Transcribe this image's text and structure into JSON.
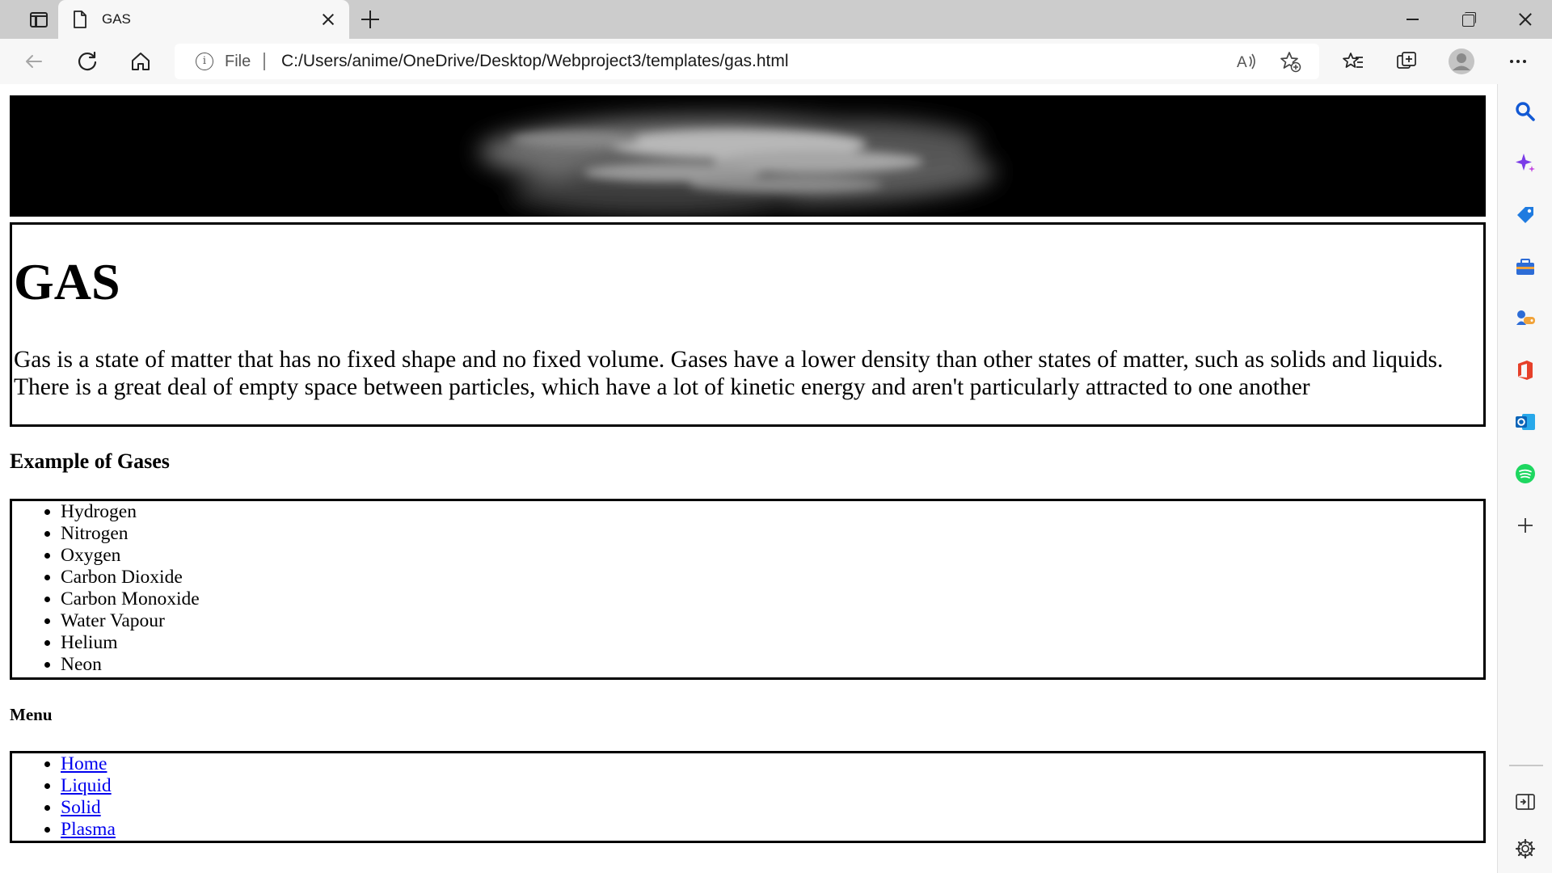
{
  "browser": {
    "tab_title": "GAS",
    "address_scheme_label": "File",
    "url": "C:/Users/anime/OneDrive/Desktop/Webproject3/templates/gas.html",
    "accent_color": "#0078d4"
  },
  "sidebar": {
    "items": [
      "search-icon",
      "copilot-icon",
      "shopping-icon",
      "tools-icon",
      "games-icon",
      "office-icon",
      "outlook-icon",
      "spotify-icon",
      "add-icon"
    ],
    "bottom": [
      "hide-sidebar-icon",
      "settings-icon"
    ]
  },
  "page": {
    "title": "GAS",
    "description": "Gas is a state of matter that has no fixed shape and no fixed volume. Gases have a lower density than other states of matter, such as solids and liquids. There is a great deal of empty space between particles, which have a lot of kinetic energy and aren't particularly attracted to one another",
    "examples_heading": "Example of Gases",
    "examples": [
      "Hydrogen",
      "Nitrogen",
      "Oxygen",
      "Carbon Dioxide",
      "Carbon Monoxide",
      "Water Vapour",
      "Helium",
      "Neon"
    ],
    "menu_heading": "Menu",
    "menu": [
      "Home",
      "Liquid",
      "Solid",
      "Plasma"
    ],
    "link_color": "#0000ee"
  }
}
